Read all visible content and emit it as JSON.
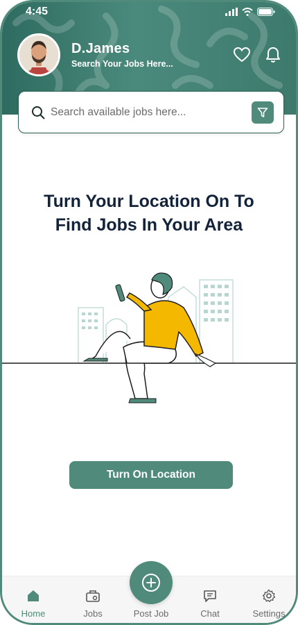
{
  "status_bar": {
    "time": "4:45"
  },
  "profile": {
    "name": "D.James",
    "subtitle": "Search Your Jobs Here..."
  },
  "search": {
    "placeholder": "Search available jobs here..."
  },
  "main": {
    "headline_line1": "Turn Your Location On To",
    "headline_line2": "Find Jobs In Your Area",
    "cta_label": "Turn On Location"
  },
  "nav": {
    "items": [
      {
        "label": "Home",
        "icon": "home-icon",
        "active": true
      },
      {
        "label": "Jobs",
        "icon": "briefcase-icon",
        "active": false
      },
      {
        "label": "Post Job",
        "icon": "plus-circle-icon",
        "active": false
      },
      {
        "label": "Chat",
        "icon": "chat-icon",
        "active": false
      },
      {
        "label": "Settings",
        "icon": "gear-icon",
        "active": false
      }
    ]
  },
  "colors": {
    "primary": "#4f8a7a",
    "header_dark": "#2e6b60",
    "accent_yellow": "#f5b800",
    "text_dark": "#13233a"
  }
}
